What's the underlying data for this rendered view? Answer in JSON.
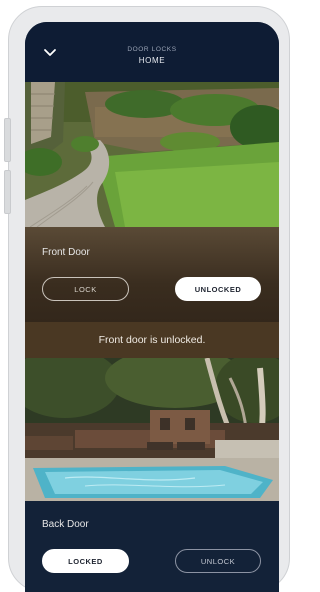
{
  "header": {
    "subtitle": "DOOR LOCKS",
    "title": "HOME"
  },
  "doors": [
    {
      "name": "Front Door",
      "lock_label": "LOCK",
      "unlock_label": "UNLOCKED",
      "active": "unlocked",
      "status_message": "Front door is unlocked."
    },
    {
      "name": "Back Door",
      "lock_label": "LOCKED",
      "unlock_label": "UNLOCK",
      "active": "locked"
    }
  ],
  "colors": {
    "header_bg": "#0e1c34",
    "front_panel_bg": "#3a2d1f",
    "status_bar_bg": "#4a3823",
    "back_panel_bg": "#132238",
    "active_pill": "#ffffff"
  },
  "icons": {
    "back": "chevron-down-icon"
  }
}
